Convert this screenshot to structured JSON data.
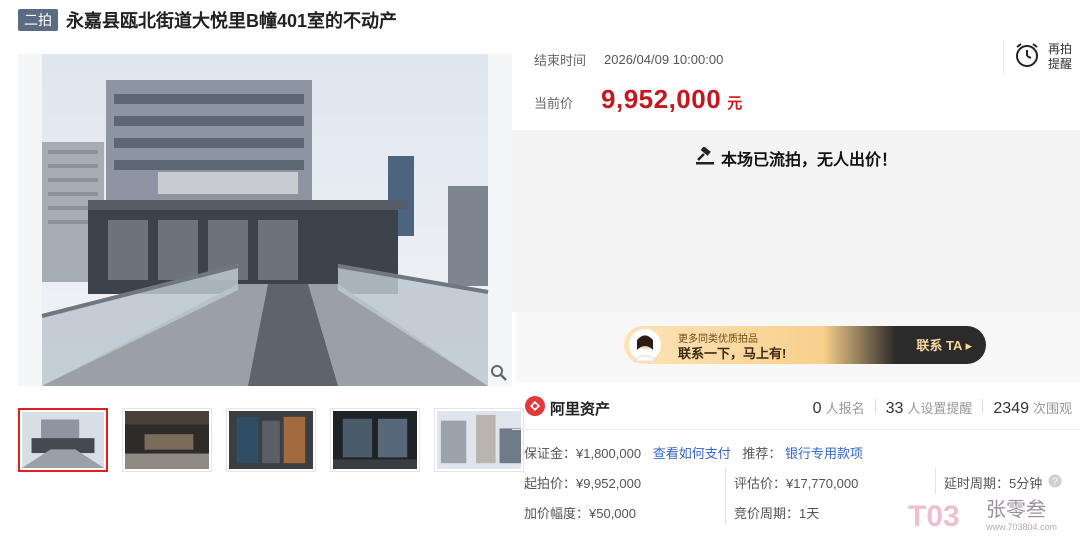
{
  "title": {
    "badge": "二拍",
    "text": "永嘉县瓯北街道大悦里B幢401室的不动产"
  },
  "auction": {
    "end_label": "结束时间",
    "end_value": "2026/04/09 10:00:00",
    "price_label": "当前价",
    "price_value": "9,952,000",
    "price_unit": "元",
    "remind_label": "再拍提醒",
    "status": "本场已流拍，无人出价！"
  },
  "banner": {
    "sub": "更多同类优质拍品",
    "main": "联系一下，马上有!",
    "button": "联系 TA ▸"
  },
  "brand": {
    "name": "阿里资产"
  },
  "stats": [
    {
      "num": "0",
      "label": "人报名"
    },
    {
      "num": "33",
      "label": "人设置提醒"
    },
    {
      "num": "2349",
      "label": "次围观"
    }
  ],
  "details": {
    "deposit": "保证金：¥1,800,000",
    "how_pay": "查看如何支付",
    "recommend": "推荐：",
    "bank": "银行专用款项",
    "start_price": "起拍价：¥9,952,000",
    "eval_price": "评估价：¥17,770,000",
    "delay": "延时周期：5分钟",
    "increment": "加价幅度：¥50,000",
    "bid_cycle": "竞价周期：1天"
  },
  "watermark": {
    "brand": "张零叁",
    "url": "www.703804.com",
    "logo": "T03"
  },
  "colors": {
    "price_red": "#c8161d",
    "link_blue": "#3366cc",
    "badge_bg": "#5b6b85"
  }
}
